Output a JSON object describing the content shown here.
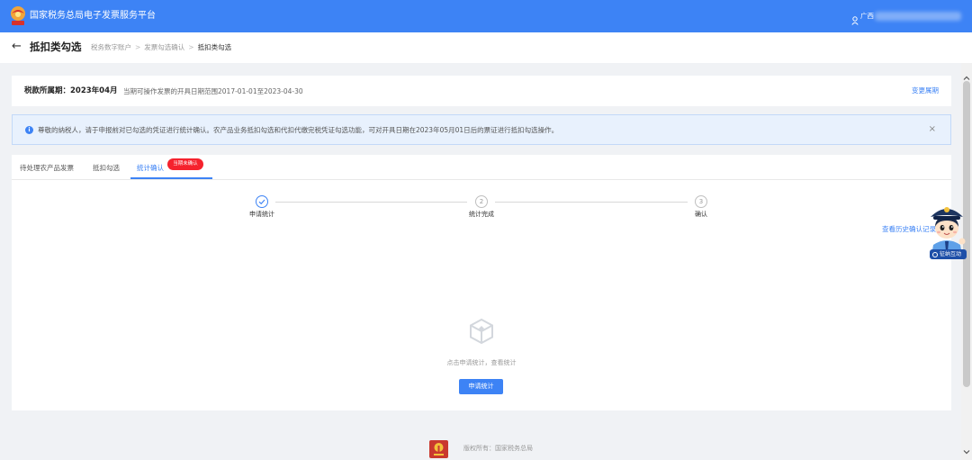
{
  "colors": {
    "primary": "#3d83f5",
    "header": "#3d83f5",
    "badge": "#f5222d",
    "alert_bg": "#e8f1fd"
  },
  "header": {
    "logo_icon": "tax-emblem-icon",
    "title": "国家税务总局电子发票服务平台",
    "user_icon": "user-icon",
    "user_name": "广西"
  },
  "nav": {
    "back_icon": "arrow-left-icon",
    "back_glyph": "←",
    "title": "抵扣类勾选",
    "breadcrumb": [
      "税务数字账户",
      "发票勾选确认",
      "抵扣类勾选"
    ],
    "separator": ">"
  },
  "period": {
    "label": "税款所属期：2023年04月",
    "note": "当期可操作发票的开具日期范围2017-01-01至2023-04-30",
    "change_link": "变更属期"
  },
  "alert": {
    "icon": "info-icon",
    "icon_glyph": "i",
    "text": "尊敬的纳税人，请于申报前对已勾选的凭证进行统计确认。农产品业务抵扣勾选和代扣代缴完税凭证勾选功能，可对开具日期在2023年05月01日后的票证进行抵扣勾选操作。",
    "close_icon": "close-icon",
    "close_glyph": "×"
  },
  "tabs": [
    {
      "label": "待处理农产品发票",
      "active": false
    },
    {
      "label": "抵扣勾选",
      "active": false
    },
    {
      "label": "统计确认",
      "active": true,
      "badge": "当期未确认"
    }
  ],
  "steps": [
    {
      "label": "申请统计",
      "completed": true,
      "icon": "check-circle-icon"
    },
    {
      "number": "2",
      "label": "统计完成",
      "completed": false
    },
    {
      "number": "3",
      "label": "确认",
      "completed": false
    }
  ],
  "history_link": "查看历史确认记录",
  "empty_state": {
    "icon": "empty-box-icon",
    "text": "点击申请统计，查看统计",
    "button": "申请统计"
  },
  "assistant": {
    "icon": "assistant-mascot-icon",
    "badge": "征纳互动"
  },
  "footer": {
    "emblem_icon": "tax-emblem-icon",
    "copyright": "版权所有：国家税务总局"
  },
  "scrollbar": {
    "up_icon": "chevron-up-icon",
    "down_icon": "chevron-down-icon"
  }
}
